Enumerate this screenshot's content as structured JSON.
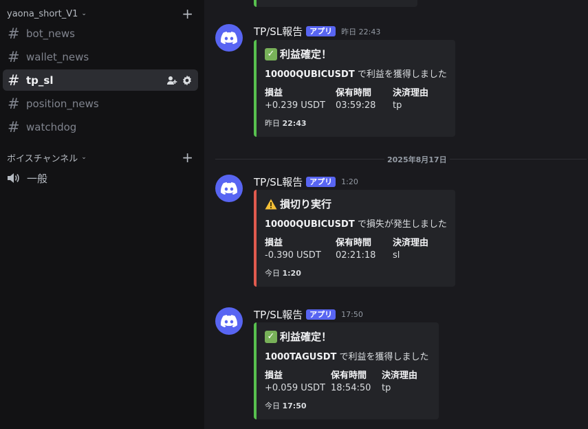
{
  "sidebar": {
    "server_category": "yaona_short_V1",
    "channels": [
      {
        "label": "bot_news"
      },
      {
        "label": "wallet_news"
      },
      {
        "label": "tp_sl"
      },
      {
        "label": "position_news"
      },
      {
        "label": "watchdog"
      }
    ],
    "voice_category": "ボイスチャンネル",
    "voice_channels": [
      {
        "label": "一般"
      }
    ]
  },
  "messages": [
    {
      "author": "TP/SL報告",
      "badge": "アプリ",
      "time": "昨日 22:43",
      "embed": {
        "color": "#57c04e",
        "title": "利益確定！",
        "desc_bold": "10000QUBICUSDT",
        "desc_rest": " で利益を獲得しました",
        "fields": [
          {
            "name": "損益",
            "value": "+0.239 USDT"
          },
          {
            "name": "保有時間",
            "value": "03:59:28"
          },
          {
            "name": "決済理由",
            "value": "tp"
          }
        ],
        "footer_day": "昨日",
        "footer_time": "22:43"
      }
    },
    {
      "author": "TP/SL報告",
      "badge": "アプリ",
      "time": "1:20",
      "embed": {
        "color": "#e05a4e",
        "title": "損切り実行",
        "desc_bold": "10000QUBICUSDT",
        "desc_rest": " で損失が発生しました",
        "fields": [
          {
            "name": "損益",
            "value": "-0.390 USDT"
          },
          {
            "name": "保有時間",
            "value": "02:21:18"
          },
          {
            "name": "決済理由",
            "value": "sl"
          }
        ],
        "footer_day": "今日",
        "footer_time": "1:20"
      }
    },
    {
      "author": "TP/SL報告",
      "badge": "アプリ",
      "time": "17:50",
      "embed": {
        "color": "#57c04e",
        "title": "利益確定！",
        "desc_bold": "1000TAGUSDT",
        "desc_rest": " で利益を獲得しました",
        "fields": [
          {
            "name": "損益",
            "value": "+0.059 USDT"
          },
          {
            "name": "保有時間",
            "value": "18:54:50"
          },
          {
            "name": "決済理由",
            "value": "tp"
          }
        ],
        "footer_day": "今日",
        "footer_time": "17:50"
      }
    }
  ],
  "date_divider": "2025年8月17日",
  "icons": {
    "channel": "hash-icon",
    "voice": "speaker-icon",
    "avatar": "discord-logo-icon",
    "success": "check-mark-icon",
    "warning": "warning-icon",
    "add_member": "add-member-icon",
    "settings": "gear-icon",
    "add": "plus-icon"
  },
  "colors": {
    "blurple": "#5865f2",
    "success": "#57c04e",
    "danger": "#e05a4e"
  }
}
